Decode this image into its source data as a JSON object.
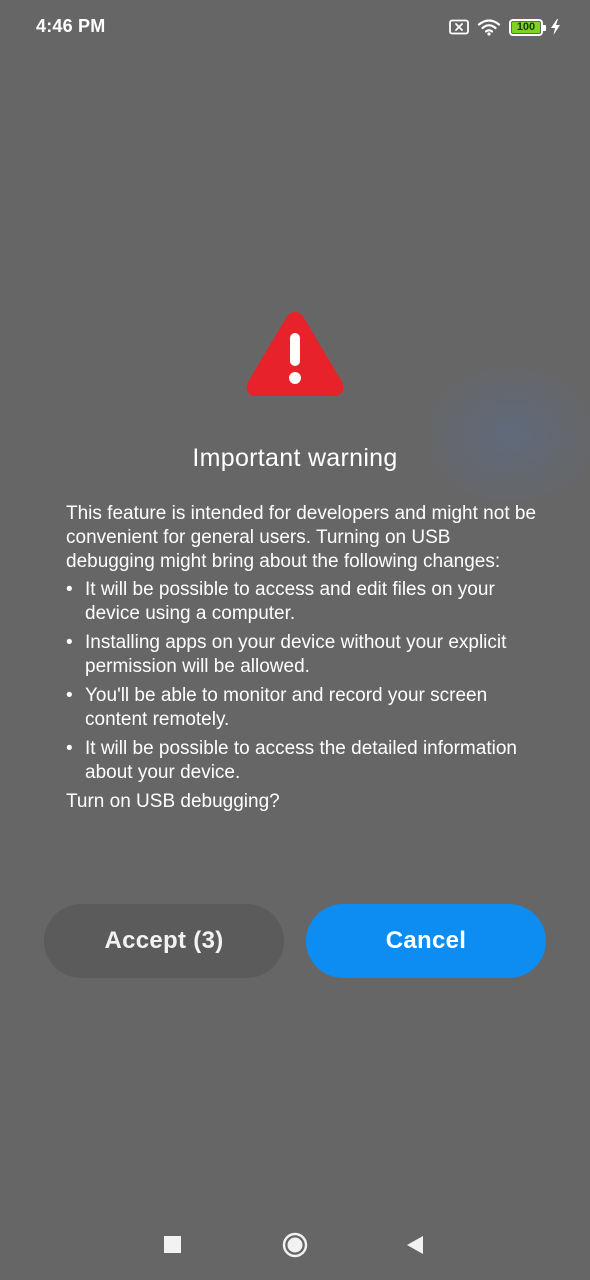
{
  "status_bar": {
    "time": "4:46 PM",
    "battery_level": "100",
    "icons": [
      "sim-card-x-icon",
      "wifi-icon",
      "battery-icon",
      "charging-bolt-icon"
    ]
  },
  "dialog": {
    "icon": "warning-triangle-icon",
    "title": "Important warning",
    "intro": "This feature is intended for developers and might not be convenient for general users. Turning on USB debugging might bring about the following changes:",
    "bullet_symbol": "•",
    "bullets": [
      "It will be possible to access and edit files on your device using a computer.",
      "Installing apps on your device without your explicit permission will be allowed.",
      "You'll be able to monitor and record your screen content remotely.",
      "It will be possible to access the detailed information about your device."
    ],
    "question": "Turn on USB debugging?",
    "accept_label": "Accept (3)",
    "cancel_label": "Cancel"
  },
  "nav_bar": {
    "icons": [
      "recents-square-icon",
      "home-circle-icon",
      "back-triangle-icon"
    ]
  },
  "colors": {
    "background": "#666666",
    "warning_red": "#e8222a",
    "cancel_blue": "#0d8cf2",
    "accept_gray": "#5b5b5b",
    "battery_green": "#7fd321"
  }
}
